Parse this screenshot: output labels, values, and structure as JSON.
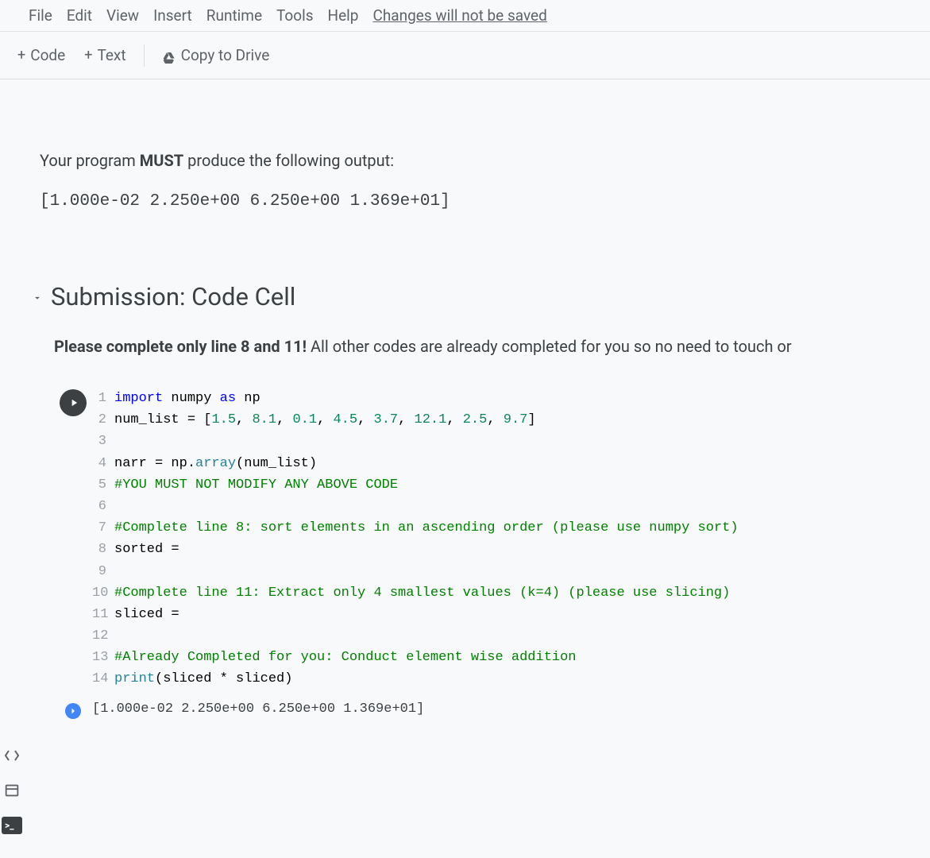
{
  "menu": {
    "file": "File",
    "edit": "Edit",
    "view": "View",
    "insert": "Insert",
    "runtime": "Runtime",
    "tools": "Tools",
    "help": "Help",
    "changes_notice": "Changes will not be saved"
  },
  "toolbar": {
    "add_code": "Code",
    "add_text": "Text",
    "copy_to_drive": "Copy to Drive"
  },
  "text_cell": {
    "intro_prefix": "Your program ",
    "intro_must": "MUST",
    "intro_suffix": " produce the following output:",
    "expected_output": "[1.000e-02 2.250e+00 6.250e+00 1.369e+01]"
  },
  "section": {
    "title": "Submission: Code Cell",
    "instruction_prefix": "Please complete only line 8 and 11!",
    "instruction_suffix": " All other codes are already completed for you so no need to touch or"
  },
  "code": {
    "lines": [
      {
        "n": "1",
        "tokens": [
          [
            "kw",
            "import"
          ],
          [
            "var",
            " numpy "
          ],
          [
            "kw",
            "as"
          ],
          [
            "var",
            " np"
          ]
        ]
      },
      {
        "n": "2",
        "tokens": [
          [
            "var",
            "num_list "
          ],
          [
            "op",
            "="
          ],
          [
            "var",
            " "
          ],
          [
            "op",
            "["
          ],
          [
            "num",
            "1.5"
          ],
          [
            "op",
            ", "
          ],
          [
            "num",
            "8.1"
          ],
          [
            "op",
            ", "
          ],
          [
            "num",
            "0.1"
          ],
          [
            "op",
            ", "
          ],
          [
            "num",
            "4.5"
          ],
          [
            "op",
            ", "
          ],
          [
            "num",
            "3.7"
          ],
          [
            "op",
            ", "
          ],
          [
            "num",
            "12.1"
          ],
          [
            "op",
            ", "
          ],
          [
            "num",
            "2.5"
          ],
          [
            "op",
            ", "
          ],
          [
            "num",
            "9.7"
          ],
          [
            "op",
            "]"
          ]
        ]
      },
      {
        "n": "3",
        "tokens": []
      },
      {
        "n": "4",
        "tokens": [
          [
            "var",
            "narr "
          ],
          [
            "op",
            "="
          ],
          [
            "var",
            " np"
          ],
          [
            "op",
            "."
          ],
          [
            "func",
            "array"
          ],
          [
            "op",
            "("
          ],
          [
            "var",
            "num_list"
          ],
          [
            "op",
            ")"
          ]
        ]
      },
      {
        "n": "5",
        "tokens": [
          [
            "comment",
            "#YOU MUST NOT MODIFY ANY ABOVE CODE"
          ]
        ]
      },
      {
        "n": "6",
        "tokens": []
      },
      {
        "n": "7",
        "tokens": [
          [
            "comment",
            "#Complete line 8: sort elements in an ascending order (please use numpy sort)"
          ]
        ]
      },
      {
        "n": "8",
        "tokens": [
          [
            "var",
            "sorted "
          ],
          [
            "op",
            "="
          ]
        ]
      },
      {
        "n": "9",
        "tokens": []
      },
      {
        "n": "10",
        "tokens": [
          [
            "comment",
            "#Complete line 11: Extract only 4 smallest values (k=4) (please use slicing)"
          ]
        ]
      },
      {
        "n": "11",
        "tokens": [
          [
            "var",
            "sliced "
          ],
          [
            "op",
            "="
          ]
        ]
      },
      {
        "n": "12",
        "tokens": []
      },
      {
        "n": "13",
        "tokens": [
          [
            "comment",
            "#Already Completed for you: Conduct element wise addition"
          ]
        ]
      },
      {
        "n": "14",
        "tokens": [
          [
            "func",
            "print"
          ],
          [
            "op",
            "("
          ],
          [
            "var",
            "sliced "
          ],
          [
            "op",
            "*"
          ],
          [
            "var",
            " sliced"
          ],
          [
            "op",
            ")"
          ]
        ]
      }
    ]
  },
  "output": {
    "text": "[1.000e-02 2.250e+00 6.250e+00 1.369e+01]"
  }
}
